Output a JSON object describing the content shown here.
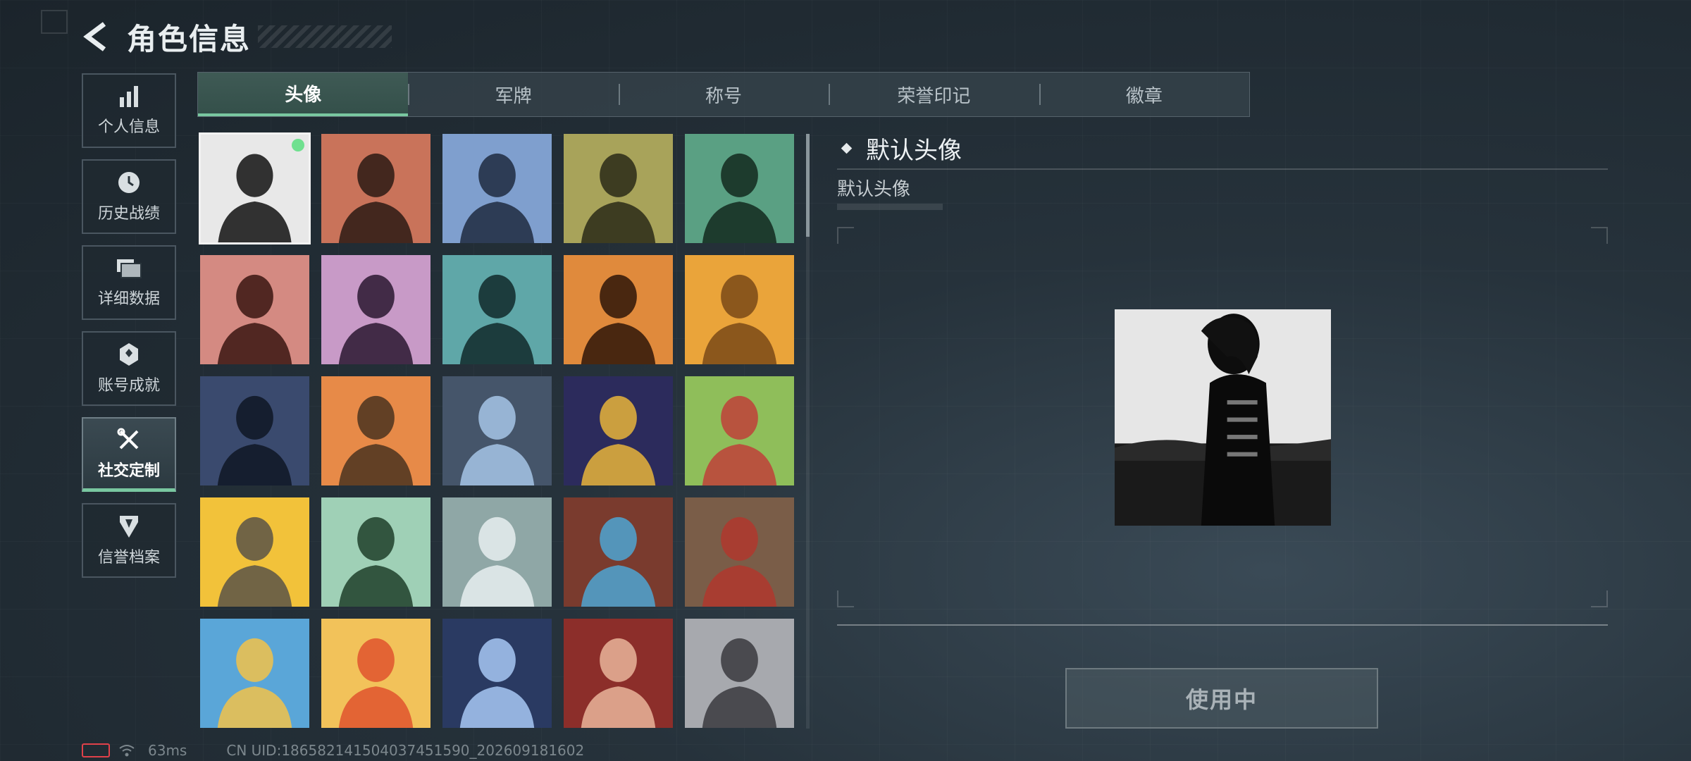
{
  "header": {
    "title": "角色信息"
  },
  "sidebar": {
    "items": [
      {
        "label": "个人信息",
        "icon": "bar-chart-icon"
      },
      {
        "label": "历史战绩",
        "icon": "history-icon"
      },
      {
        "label": "详细数据",
        "icon": "folder-icon"
      },
      {
        "label": "账号成就",
        "icon": "medal-icon"
      },
      {
        "label": "社交定制",
        "icon": "tools-icon",
        "active": true
      },
      {
        "label": "信誉档案",
        "icon": "shield-icon"
      }
    ]
  },
  "tabs": [
    "头像",
    "军牌",
    "称号",
    "荣誉印记",
    "徽章"
  ],
  "active_tab": "头像",
  "avatars": [
    {
      "name": "avatar-default-silhouette",
      "bg": "#e8e8e8",
      "fg": "#111111",
      "selected": true
    },
    {
      "name": "avatar-soldier-cap",
      "bg": "#c9735a",
      "fg": "#2b1a14"
    },
    {
      "name": "avatar-pilot-woman",
      "bg": "#7f9fce",
      "fg": "#1e2a40"
    },
    {
      "name": "avatar-bald-bearded",
      "bg": "#a8a35a",
      "fg": "#2a2a18"
    },
    {
      "name": "avatar-headset-smile",
      "bg": "#5aa083",
      "fg": "#13291f"
    },
    {
      "name": "avatar-helmet-woman",
      "bg": "#d48a82",
      "fg": "#3a1512"
    },
    {
      "name": "avatar-white-hair-girl",
      "bg": "#c89ac7",
      "fg": "#2a1830"
    },
    {
      "name": "avatar-glasses-beard",
      "bg": "#5fa7a8",
      "fg": "#10292a"
    },
    {
      "name": "avatar-masked-man",
      "bg": "#e08a3c",
      "fg": "#2e1508"
    },
    {
      "name": "avatar-triangle-emblem",
      "bg": "#eaa43a",
      "fg": "#7a4a18"
    },
    {
      "name": "avatar-night-soldier",
      "bg": "#3a4a6e",
      "fg": "#0f1624"
    },
    {
      "name": "avatar-thumbs-up-soldier",
      "bg": "#e78a48",
      "fg": "#4a3220"
    },
    {
      "name": "avatar-rifle-scope",
      "bg": "#45556a",
      "fg": "#a6c6e6"
    },
    {
      "name": "avatar-game-card",
      "bg": "#2c2b5c",
      "fg": "#e8b43a"
    },
    {
      "name": "avatar-exit-door",
      "bg": "#8fbe5a",
      "fg": "#c0413a"
    },
    {
      "name": "avatar-pizza-robot",
      "bg": "#f2c23a",
      "fg": "#5b5348"
    },
    {
      "name": "avatar-way-out-sign",
      "bg": "#9fd0b6",
      "fg": "#1f3f2a"
    },
    {
      "name": "avatar-diamond-hand",
      "bg": "#8fa7a6",
      "fg": "#e7eef0"
    },
    {
      "name": "avatar-feather",
      "bg": "#7a3b2e",
      "fg": "#4ea6d2"
    },
    {
      "name": "avatar-scales-badge",
      "bg": "#7a5d48",
      "fg": "#b0372e"
    },
    {
      "name": "avatar-party-man",
      "bg": "#5aa6d8",
      "fg": "#f2c24a"
    },
    {
      "name": "avatar-hotdog-mascot",
      "bg": "#f2c25a",
      "fg": "#e0532e"
    },
    {
      "name": "avatar-lightning-machine",
      "bg": "#2a3a62",
      "fg": "#a7c8f4"
    },
    {
      "name": "avatar-red-hair-woman",
      "bg": "#8c2e2a",
      "fg": "#e9b49a"
    },
    {
      "name": "avatar-mountain-soldier",
      "bg": "#a7a9ae",
      "fg": "#3a3a3e"
    }
  ],
  "detail": {
    "title": "默认头像",
    "subtitle": "默认头像",
    "button_label": "使用中"
  },
  "status": {
    "ping": "63ms",
    "uid": "CN UID:1865821415040374515​90_202609181602"
  },
  "colors": {
    "accent": "#79c7a0",
    "online_dot": "#6fe08f",
    "battery_low": "#e0414a"
  }
}
